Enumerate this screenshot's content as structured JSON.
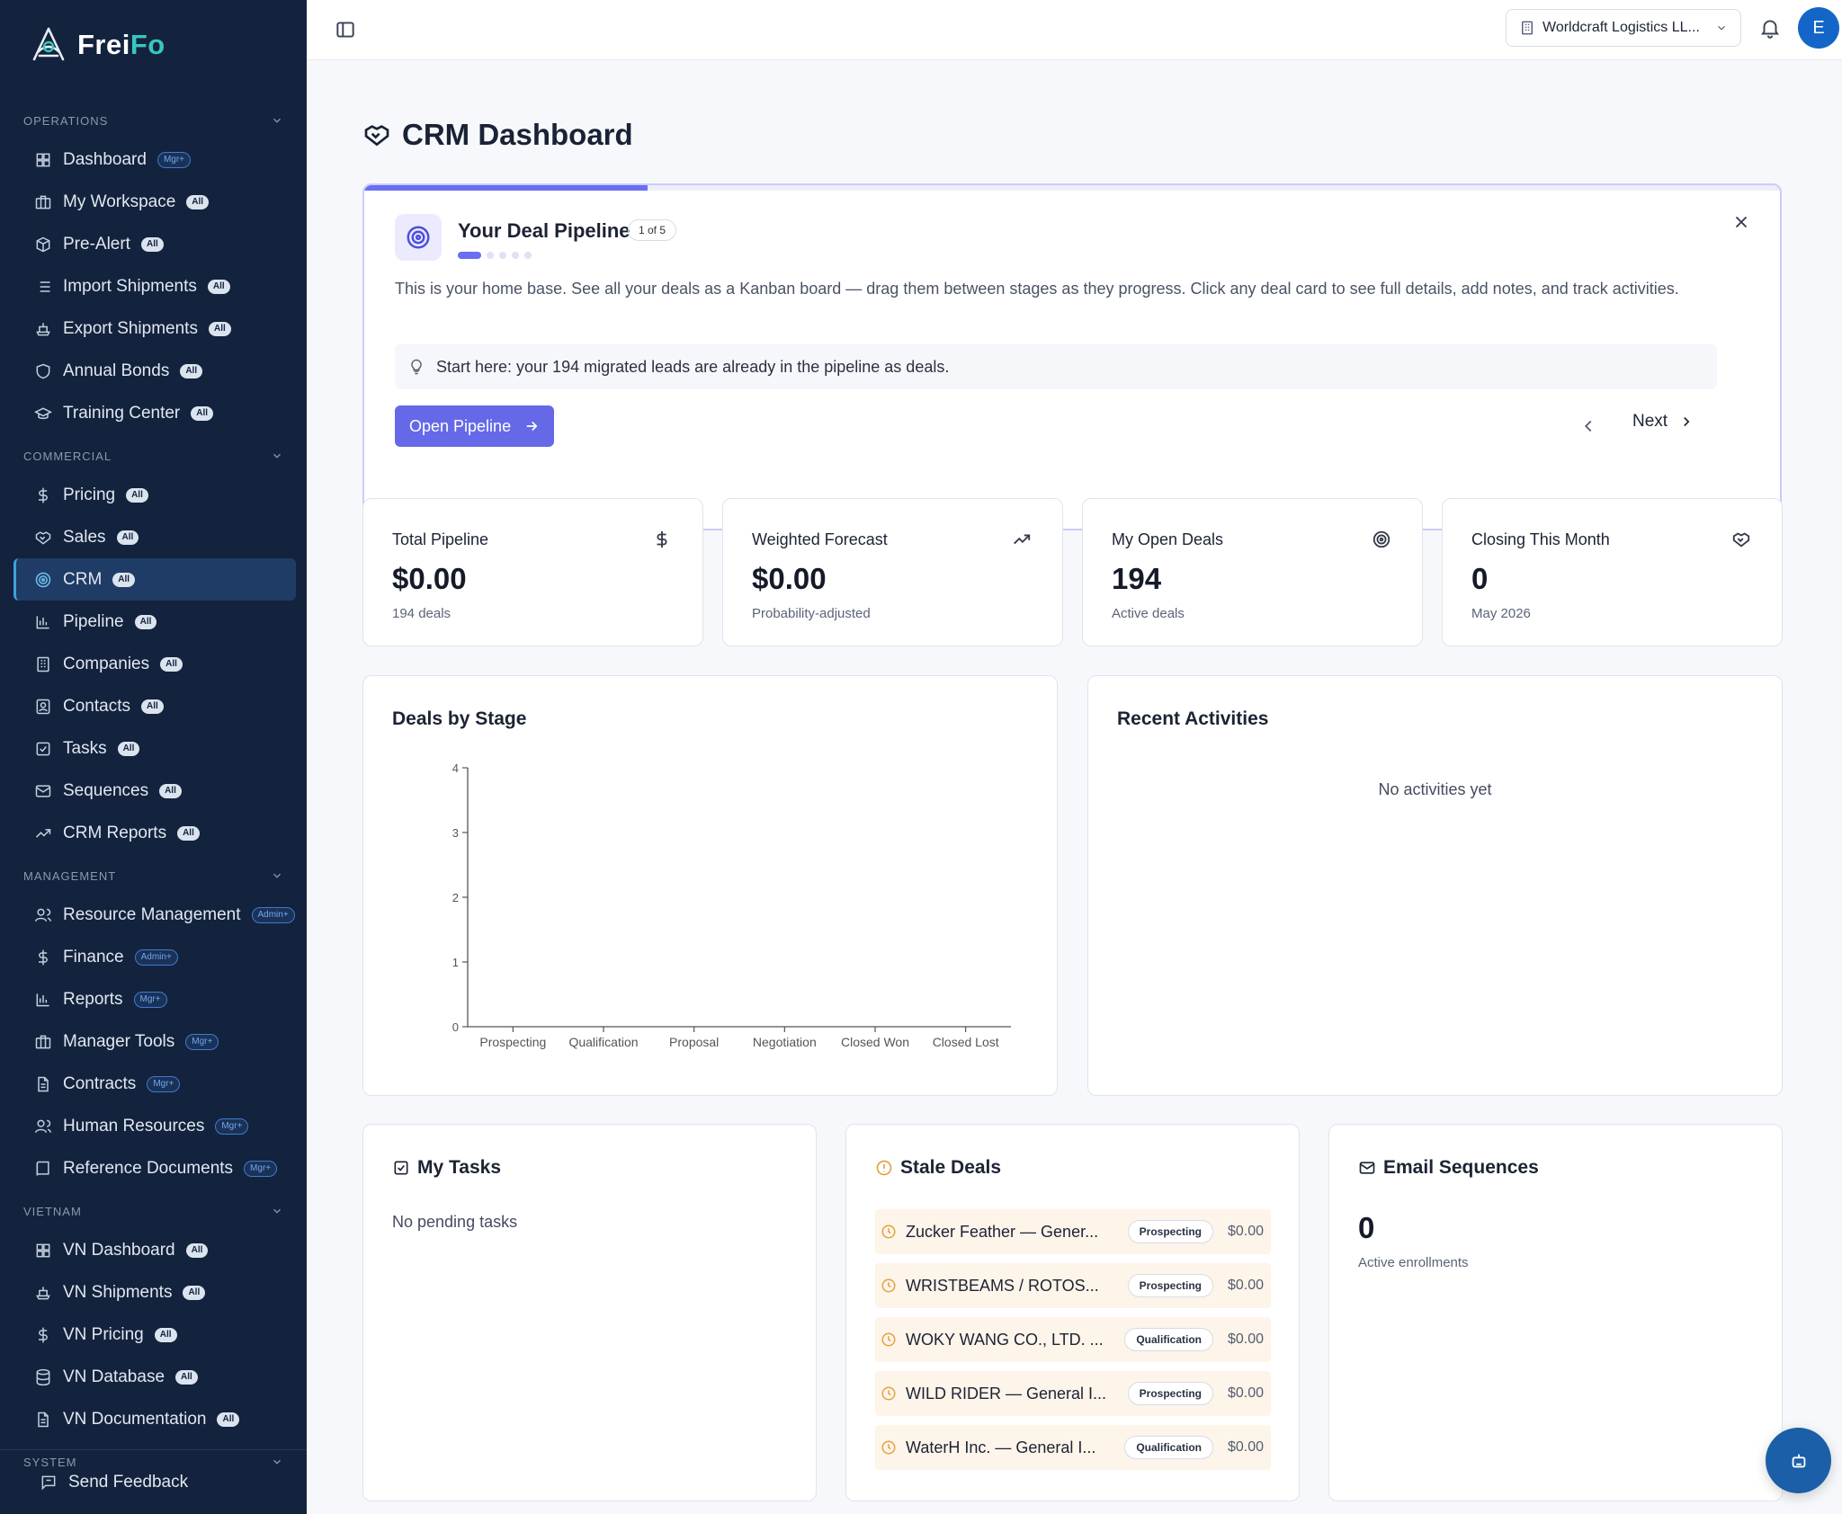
{
  "brand": {
    "name_part1": "Frei",
    "name_part2": "Fo"
  },
  "sidebar": {
    "sections": [
      {
        "title": "OPERATIONS",
        "items": [
          {
            "label": "Dashboard",
            "badge": "Mgr+",
            "icon": "layout-grid-icon"
          },
          {
            "label": "My Workspace",
            "badge": "All",
            "icon": "briefcase-icon"
          },
          {
            "label": "Pre-Alert",
            "badge": "All",
            "icon": "package-icon"
          },
          {
            "label": "Import Shipments",
            "badge": "All",
            "icon": "list-icon"
          },
          {
            "label": "Export Shipments",
            "badge": "All",
            "icon": "ship-icon"
          },
          {
            "label": "Annual Bonds",
            "badge": "All",
            "icon": "shield-icon"
          },
          {
            "label": "Training Center",
            "badge": "All",
            "icon": "graduation-cap-icon"
          }
        ]
      },
      {
        "title": "COMMERCIAL",
        "items": [
          {
            "label": "Pricing",
            "badge": "All",
            "icon": "dollar-icon"
          },
          {
            "label": "Sales",
            "badge": "All",
            "icon": "handshake-icon"
          },
          {
            "label": "CRM",
            "badge": "All",
            "icon": "target-icon",
            "active": true
          },
          {
            "label": "Pipeline",
            "badge": "All",
            "icon": "bar-chart-icon"
          },
          {
            "label": "Companies",
            "badge": "All",
            "icon": "building-icon"
          },
          {
            "label": "Contacts",
            "badge": "All",
            "icon": "contact-icon"
          },
          {
            "label": "Tasks",
            "badge": "All",
            "icon": "check-square-icon"
          },
          {
            "label": "Sequences",
            "badge": "All",
            "icon": "mail-icon"
          },
          {
            "label": "CRM Reports",
            "badge": "All",
            "icon": "trend-icon"
          }
        ]
      },
      {
        "title": "MANAGEMENT",
        "items": [
          {
            "label": "Resource Management",
            "badge": "Admin+",
            "icon": "users-icon"
          },
          {
            "label": "Finance",
            "badge": "Admin+",
            "icon": "dollar-icon"
          },
          {
            "label": "Reports",
            "badge": "Mgr+",
            "icon": "bar-chart-icon"
          },
          {
            "label": "Manager Tools",
            "badge": "Mgr+",
            "icon": "briefcase-icon"
          },
          {
            "label": "Contracts",
            "badge": "Mgr+",
            "icon": "file-icon"
          },
          {
            "label": "Human Resources",
            "badge": "Mgr+",
            "icon": "users-icon"
          },
          {
            "label": "Reference Documents",
            "badge": "Mgr+",
            "icon": "book-icon"
          }
        ]
      },
      {
        "title": "VIETNAM",
        "items": [
          {
            "label": "VN Dashboard",
            "badge": "All",
            "icon": "layout-grid-icon"
          },
          {
            "label": "VN Shipments",
            "badge": "All",
            "icon": "ship-icon"
          },
          {
            "label": "VN Pricing",
            "badge": "All",
            "icon": "dollar-icon"
          },
          {
            "label": "VN Database",
            "badge": "All",
            "icon": "database-icon"
          },
          {
            "label": "VN Documentation",
            "badge": "All",
            "icon": "file-icon"
          }
        ]
      },
      {
        "title": "SYSTEM",
        "items": []
      }
    ],
    "feedback_label": "Send Feedback"
  },
  "topbar": {
    "org_name": "Worldcraft Logistics LL...",
    "avatar_initial": "E"
  },
  "page": {
    "title": "CRM Dashboard"
  },
  "onboarding": {
    "title": "Your Deal Pipeline",
    "step": "1 of 5",
    "progress": 0.2,
    "current_step": 1,
    "total_steps": 5,
    "description": "This is your home base. See all your deals as a Kanban board — drag them between stages as they progress. Click any deal card to see full details, add notes, and track activities.",
    "tip": "Start here: your 194 migrated leads are already in the pipeline as deals.",
    "button_label": "Open Pipeline",
    "next_label": "Next"
  },
  "stats": [
    {
      "label": "Total Pipeline",
      "value": "$0.00",
      "sub": "194 deals",
      "icon": "dollar-icon"
    },
    {
      "label": "Weighted Forecast",
      "value": "$0.00",
      "sub": "Probability-adjusted",
      "icon": "trend-icon"
    },
    {
      "label": "My Open Deals",
      "value": "194",
      "sub": "Active deals",
      "icon": "target-icon"
    },
    {
      "label": "Closing This Month",
      "value": "0",
      "sub": "May 2026",
      "icon": "handshake-icon"
    }
  ],
  "chart_title": "Deals by Stage",
  "chart_data": {
    "type": "bar",
    "title": "Deals by Stage",
    "categories": [
      "Prospecting",
      "Qualification",
      "Proposal",
      "Negotiation",
      "Closed Won",
      "Closed Lost"
    ],
    "values": [
      0,
      0,
      0,
      0,
      0,
      0
    ],
    "ylim": [
      0,
      4
    ],
    "yticks": [
      0,
      1,
      2,
      3,
      4
    ],
    "xlabel": "",
    "ylabel": ""
  },
  "activities": {
    "title": "Recent Activities",
    "empty": "No activities yet"
  },
  "tasks": {
    "title": "My Tasks",
    "empty": "No pending tasks"
  },
  "stale": {
    "title": "Stale Deals",
    "rows": [
      {
        "name": "Zucker Feather — Gener...",
        "stage": "Prospecting",
        "amount": "$0.00"
      },
      {
        "name": "WRISTBEAMS / ROTOS...",
        "stage": "Prospecting",
        "amount": "$0.00"
      },
      {
        "name": "WOKY WANG CO., LTD. ...",
        "stage": "Qualification",
        "amount": "$0.00"
      },
      {
        "name": "WILD RIDER — General I...",
        "stage": "Prospecting",
        "amount": "$0.00"
      },
      {
        "name": "WaterH Inc. — General I...",
        "stage": "Qualification",
        "amount": "$0.00"
      }
    ]
  },
  "email_seq": {
    "title": "Email Sequences",
    "value": "0",
    "sub": "Active enrollments"
  },
  "colors": {
    "sidebar_bg": "#13233d",
    "accent": "#6569e8",
    "brand_teal": "#38c6c0",
    "stale_bg": "#fdf4ea"
  }
}
